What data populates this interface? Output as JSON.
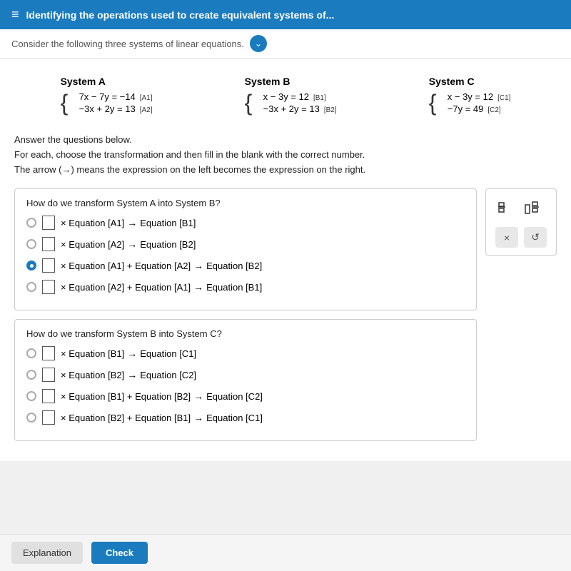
{
  "header": {
    "menu_icon": "≡",
    "title": "Identifying the operations used to create equivalent systems of..."
  },
  "sub_header": {
    "text": "Consider the following three systems of linear equations."
  },
  "systems": {
    "system_a": {
      "title": "System A",
      "eq1": "7x − 7y = −14",
      "eq1_label": "[A1]",
      "eq2": "−3x + 2y = 13",
      "eq2_label": "[A2]"
    },
    "system_b": {
      "title": "System B",
      "eq1": "x − 3y = 12",
      "eq1_label": "[B1]",
      "eq2": "−3x + 2y = 13",
      "eq2_label": "[B2]"
    },
    "system_c": {
      "title": "System C",
      "eq1": "x − 3y = 12",
      "eq1_label": "[C1]",
      "eq2": "−7y = 49",
      "eq2_label": "[C2]"
    }
  },
  "instructions": {
    "line1": "Answer the questions below.",
    "line2": "For each, choose the transformation and then fill in the blank with the correct number.",
    "line3_prefix": "The arrow (",
    "arrow": "→",
    "line3_suffix": ") means the expression on the left becomes the expression on the right."
  },
  "question1": {
    "prompt": "How do we transform System A into System B?",
    "options": [
      {
        "id": "q1o1",
        "selected": false,
        "text_parts": [
          "× Equation [A1]",
          "→",
          "Equation [B1]"
        ]
      },
      {
        "id": "q1o2",
        "selected": false,
        "text_parts": [
          "× Equation [A2]",
          "→",
          "Equation [B2]"
        ]
      },
      {
        "id": "q1o3",
        "selected": true,
        "text_parts": [
          "× Equation [A1] + Equation [A2]",
          "→",
          "Equation [B2]"
        ]
      },
      {
        "id": "q1o4",
        "selected": false,
        "text_parts": [
          "× Equation [A2] + Equation [A1]",
          "→",
          "Equation [B1]"
        ]
      }
    ]
  },
  "question2": {
    "prompt": "How do we transform System B into System C?",
    "options": [
      {
        "id": "q2o1",
        "selected": false,
        "text_parts": [
          "× Equation [B1]",
          "→",
          "Equation [C1]"
        ]
      },
      {
        "id": "q2o2",
        "selected": false,
        "text_parts": [
          "× Equation [B2]",
          "→",
          "Equation [C2]"
        ]
      },
      {
        "id": "q2o3",
        "selected": false,
        "text_parts": [
          "× Equation [B1] + Equation [B2]",
          "→",
          "Equation [C2]"
        ]
      },
      {
        "id": "q2o4",
        "selected": false,
        "text_parts": [
          "× Equation [B2] + Equation [B1]",
          "→",
          "Equation [C1]"
        ]
      }
    ]
  },
  "tools": {
    "fraction_icon": "□/□",
    "mixed_fraction_icon": "□□/□",
    "times_label": "×",
    "undo_label": "↺"
  },
  "footer": {
    "explanation_label": "Explanation",
    "check_label": "Check"
  }
}
